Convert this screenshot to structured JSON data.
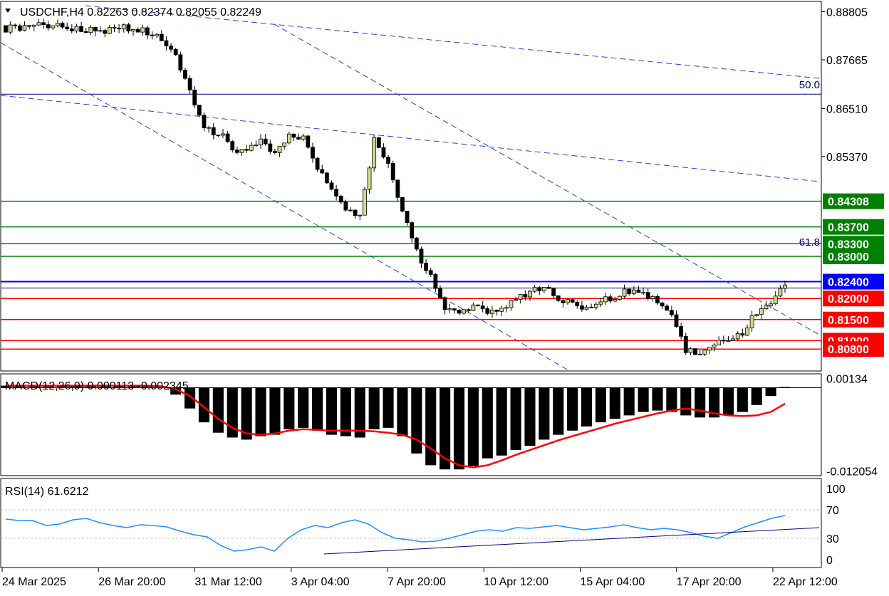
{
  "chart_data": [
    {
      "type": "candlestick",
      "symbol": "USDCHF",
      "timeframe": "H4",
      "ohlc_header": {
        "open": "0.82263",
        "high": "0.82374",
        "low": "0.82055",
        "close": "0.82249"
      },
      "price_axis_ticks": [
        "0.88805",
        "0.87665",
        "0.86510",
        "0.85370"
      ],
      "price_range": [
        0.8028,
        0.8905
      ],
      "time_axis_labels": [
        "24 Mar 2025",
        "26 Mar 20:00",
        "31 Mar 12:00",
        "3 Apr 04:00",
        "7 Apr 20:00",
        "10 Apr 12:00",
        "15 Apr 04:00",
        "17 Apr 20:00",
        "22 Apr 12:00"
      ],
      "candles_close_path": [
        0.884,
        0.8842,
        0.8846,
        0.8846,
        0.8845,
        0.884,
        0.8838,
        0.8835,
        0.8847,
        0.8838,
        0.8833,
        0.882,
        0.877,
        0.869,
        0.86,
        0.8595,
        0.856,
        0.8545,
        0.8575,
        0.8545,
        0.859,
        0.858,
        0.851,
        0.8455,
        0.841,
        0.8395,
        0.858,
        0.852,
        0.841,
        0.831,
        0.825,
        0.8175,
        0.816,
        0.818,
        0.8168,
        0.8172,
        0.8198,
        0.821,
        0.8235,
        0.82,
        0.819,
        0.8175,
        0.8195,
        0.8205,
        0.822,
        0.821,
        0.819,
        0.8155,
        0.808,
        0.8068,
        0.809,
        0.81,
        0.8115,
        0.817,
        0.8195,
        0.8225
      ],
      "horizontal_levels": [
        {
          "price": 0.84308,
          "label": "0.84308",
          "color": "#008000"
        },
        {
          "price": 0.837,
          "label": "0.83700",
          "color": "#008000"
        },
        {
          "price": 0.833,
          "label": "0.83300",
          "color": "#008000"
        },
        {
          "price": 0.83,
          "label": "0.83000",
          "color": "#008000"
        },
        {
          "price": 0.824,
          "label": "0.82400",
          "color": "#0000ff"
        },
        {
          "price": 0.82249,
          "label": "",
          "color": "#666699"
        },
        {
          "price": 0.82,
          "label": "0.82000",
          "color": "#ff0000"
        },
        {
          "price": 0.815,
          "label": "0.81500",
          "color": "#ff0000"
        },
        {
          "price": 0.81,
          "label": "0.81000",
          "color": "#ff0000"
        },
        {
          "price": 0.808,
          "label": "0.80800",
          "color": "#ff0000"
        }
      ],
      "fibo_labels": [
        {
          "text": "50.0",
          "price": 0.8694
        },
        {
          "text": "61.8",
          "price": 0.832
        }
      ],
      "fibo_50_line_price": 0.8685,
      "bull_color": "#ccdd88",
      "bear_color": "#000000"
    },
    {
      "type": "histogram",
      "name": "MACD(12,26,9) 0.000113 -0.002345",
      "axis_ticks": [
        "0.00134",
        "-0.012054"
      ],
      "range": [
        -0.0125,
        0.0018
      ],
      "histogram": [
        0.0003,
        0.0003,
        0.0003,
        0.0003,
        0.0003,
        0.0003,
        0.0003,
        0.0003,
        0.0003,
        0.0003,
        0.0003,
        0.0002,
        -0.001,
        -0.003,
        -0.005,
        -0.0065,
        -0.0072,
        -0.0075,
        -0.007,
        -0.0068,
        -0.006,
        -0.0058,
        -0.0062,
        -0.0068,
        -0.007,
        -0.0072,
        -0.006,
        -0.0058,
        -0.007,
        -0.0095,
        -0.0112,
        -0.0118,
        -0.0118,
        -0.0113,
        -0.0102,
        -0.0098,
        -0.009,
        -0.0084,
        -0.0075,
        -0.0068,
        -0.0062,
        -0.0056,
        -0.005,
        -0.0045,
        -0.004,
        -0.0035,
        -0.0033,
        -0.0035,
        -0.004,
        -0.0043,
        -0.0043,
        -0.004,
        -0.0035,
        -0.0025,
        -0.0012,
        0.0001
      ],
      "signal": [
        0.0003,
        0.0003,
        0.0003,
        0.0003,
        0.0003,
        0.0003,
        0.0003,
        0.0003,
        0.0003,
        0.0003,
        0.0003,
        0.0002,
        -0.0002,
        -0.0012,
        -0.0028,
        -0.0045,
        -0.0058,
        -0.0066,
        -0.0068,
        -0.0066,
        -0.0062,
        -0.006,
        -0.0061,
        -0.0062,
        -0.0062,
        -0.0062,
        -0.0063,
        -0.0065,
        -0.0068,
        -0.0075,
        -0.0088,
        -0.0102,
        -0.0112,
        -0.0115,
        -0.0112,
        -0.0105,
        -0.0097,
        -0.009,
        -0.0083,
        -0.0076,
        -0.007,
        -0.0064,
        -0.0058,
        -0.0052,
        -0.0047,
        -0.0042,
        -0.0037,
        -0.0033,
        -0.003,
        -0.0033,
        -0.0037,
        -0.004,
        -0.0041,
        -0.004,
        -0.0035,
        -0.0023
      ],
      "histogram_color": "#000000",
      "signal_color": "#ff0000"
    },
    {
      "type": "line",
      "name": "RSI(14) 61.6212",
      "axis_ticks": [
        "100",
        "70",
        "30",
        "0"
      ],
      "levels": [
        70,
        30
      ],
      "range": [
        0,
        100
      ],
      "values": [
        57,
        55,
        55,
        48,
        50,
        56,
        58,
        52,
        48,
        45,
        49,
        48,
        46,
        40,
        35,
        32,
        20,
        12,
        14,
        18,
        12,
        30,
        42,
        48,
        45,
        52,
        56,
        50,
        38,
        30,
        28,
        25,
        26,
        30,
        35,
        40,
        42,
        40,
        45,
        44,
        46,
        48,
        45,
        42,
        44,
        46,
        49,
        45,
        42,
        44,
        42,
        38,
        33,
        30,
        38,
        46,
        52,
        58,
        62
      ],
      "trendline": {
        "from": 8,
        "to": 45
      },
      "line_color": "#1e90ff",
      "level_color": "#c0c0c0"
    }
  ]
}
